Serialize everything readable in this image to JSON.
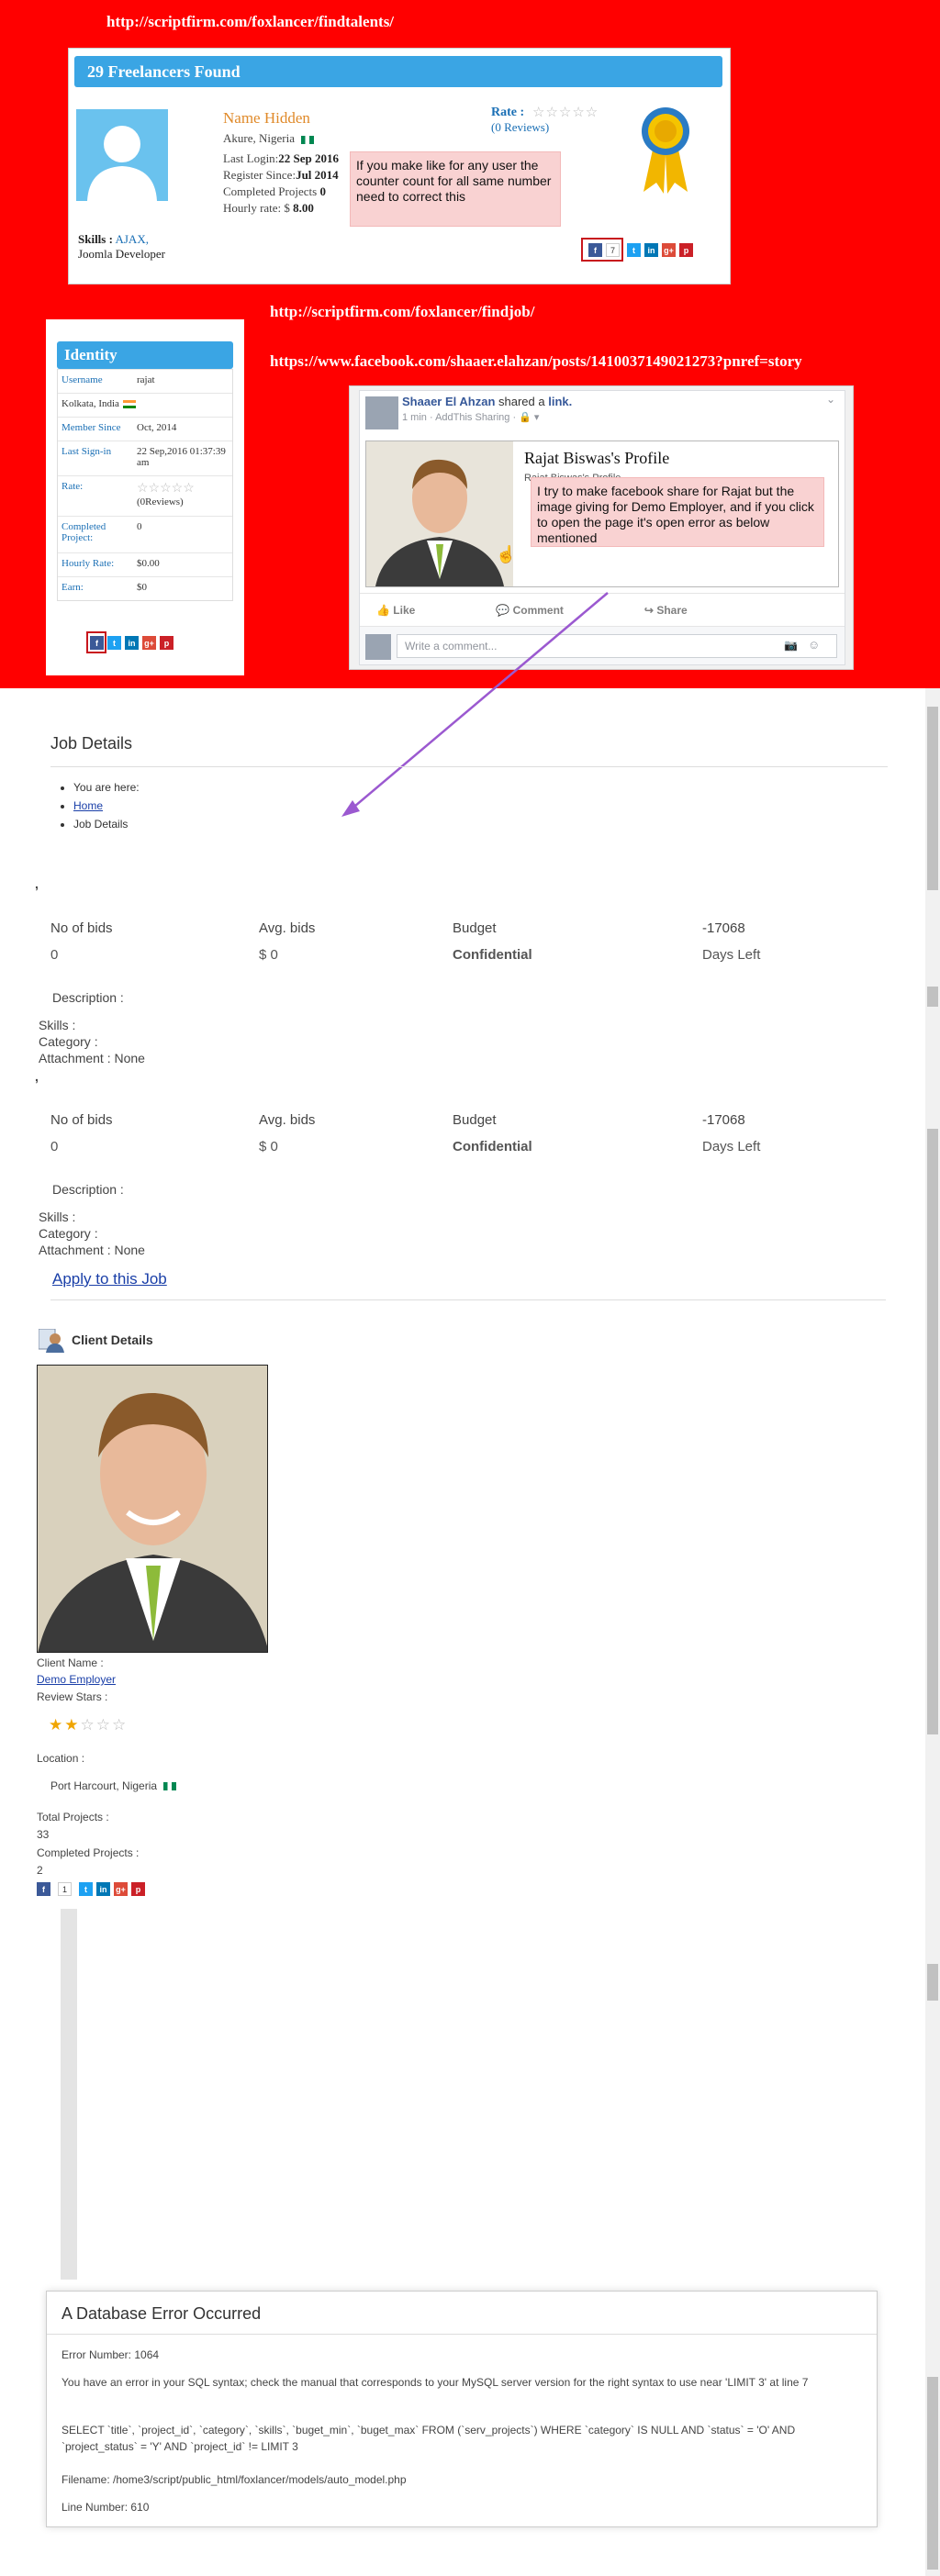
{
  "annotations": {
    "url_findtalents": "http://scriptfirm.com/foxlancer/findtalents/",
    "url_findjob": "http://scriptfirm.com/foxlancer/findjob/",
    "url_facebook": "https://www.facebook.com/shaaer.elahzan/posts/1410037149021273?pnref=story",
    "note_counter": "If you make like for any user the counter count for all same number need to correct this",
    "note_facebook": "I try to make facebook share for Rajat but the image giving for Demo Employer, and if you click to open the page it's open error as below mentioned",
    "arrow_color": "#9b59d0"
  },
  "freelancers": {
    "header": "29 Freelancers Found",
    "name": "Name Hidden",
    "location": "Akure, Nigeria",
    "last_login_label": "Last Login:",
    "last_login": "22 Sep 2016",
    "register_label": "Register Since:",
    "register": "Jul 2014",
    "completed_label": "Completed Projects",
    "completed": "0",
    "hourly_label": "Hourly rate: $",
    "hourly": "8.00",
    "rate_label": "Rate :",
    "reviews": "(0 Reviews)",
    "skills_label": "Skills :",
    "skills_value": "AJAX,",
    "skills_value2": "Joomla Developer",
    "share_count": "7"
  },
  "identity": {
    "title": "Identity",
    "rows": [
      {
        "k": "Username",
        "v": "rajat"
      },
      {
        "k": "Kolkata, India",
        "v": ""
      },
      {
        "k": "Member Since",
        "v": "Oct, 2014"
      },
      {
        "k": "Last Sign-in",
        "v": "22 Sep,2016 01:37:39 am"
      },
      {
        "k": "Rate:",
        "v": "(0Reviews)"
      },
      {
        "k": "Completed Project:",
        "v": "0"
      },
      {
        "k": "Hourly Rate:",
        "v": "$0.00"
      },
      {
        "k": "Earn:",
        "v": "$0"
      }
    ]
  },
  "facebook": {
    "author": "Shaaer El Ahzan",
    "shared": "shared a",
    "link_word": "link.",
    "meta": "1 min · AddThis Sharing · ",
    "link_title": "Rajat Biswas's Profile",
    "link_sub": "Rajat Biswas's Profile",
    "like": "Like",
    "comment": "Comment",
    "share": "Share",
    "write_comment": "Write a comment..."
  },
  "job": {
    "title": "Job Details",
    "breadcrumb": [
      "You are here:",
      "Home",
      "Job Details"
    ],
    "blocks": [
      {
        "headers": [
          "No of bids",
          "Avg. bids",
          "Budget",
          "-17068"
        ],
        "values": [
          "0",
          "$ 0",
          "Confidential",
          "Days Left"
        ],
        "description": "Description :",
        "skills": "Skills :",
        "category": "Category :",
        "attachment": "Attachment : None"
      },
      {
        "headers": [
          "No of bids",
          "Avg. bids",
          "Budget",
          "-17068"
        ],
        "values": [
          "0",
          "$ 0",
          "Confidential",
          "Days Left"
        ],
        "description": "Description :",
        "skills": "Skills :",
        "category": "Category :",
        "attachment": "Attachment : None"
      }
    ],
    "apply": "Apply to this Job"
  },
  "client": {
    "heading": "Client Details",
    "name_label": "Client Name :",
    "name": "Demo Employer",
    "review_label": "Review Stars :",
    "rating": 2,
    "rating_max": 5,
    "location_label": "Location :",
    "location": "Port Harcourt, Nigeria",
    "total_label": "Total Projects :",
    "total": "33",
    "completed_label": "Completed Projects :",
    "completed": "2",
    "share_count": "1"
  },
  "db_error": {
    "title": "A Database Error Occurred",
    "error_number": "Error Number: 1064",
    "message": "You have an error in your SQL syntax; check the manual that corresponds to your MySQL server version for the right syntax to use near 'LIMIT 3' at line 7",
    "query": "SELECT `title`, `project_id`, `category`, `skills`, `buget_min`, `buget_max` FROM (`serv_projects`) WHERE `category` IS NULL AND `status` = 'O' AND `project_status` = 'Y' AND `project_id` != LIMIT 3",
    "filename": "Filename: /home3/script/public_html/foxlancer/models/auto_model.php",
    "line": "Line Number: 610"
  }
}
